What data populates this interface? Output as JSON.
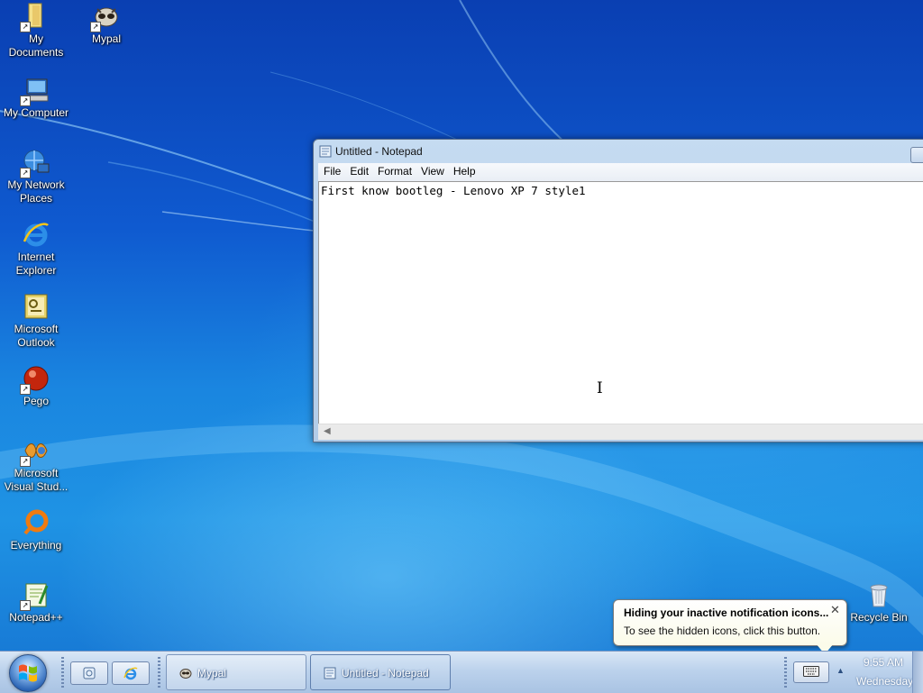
{
  "desktop": {
    "icons": [
      {
        "label": "My Documents",
        "icon": "folder-icon"
      },
      {
        "label": "Mypal",
        "icon": "mypal-icon"
      },
      {
        "label": "My Computer",
        "icon": "computer-icon"
      },
      {
        "label": "My Network Places",
        "icon": "network-icon"
      },
      {
        "label": "Internet Explorer",
        "icon": "ie-icon"
      },
      {
        "label": "Microsoft Outlook",
        "icon": "outlook-icon"
      },
      {
        "label": "Pego",
        "icon": "pego-icon"
      },
      {
        "label": "Microsoft Visual Stud...",
        "icon": "visual-studio-icon"
      },
      {
        "label": "Everything",
        "icon": "everything-icon"
      },
      {
        "label": "Notepad++",
        "icon": "notepadpp-icon"
      },
      {
        "label": "Recycle Bin",
        "icon": "recycle-bin-icon"
      }
    ]
  },
  "notepad": {
    "title": "Untitled - Notepad",
    "menu": [
      "File",
      "Edit",
      "Format",
      "View",
      "Help"
    ],
    "content": "First know bootleg - Lenovo XP 7 style1"
  },
  "balloon": {
    "title": "Hiding your inactive notification icons...",
    "body": "To see the hidden icons, click this button."
  },
  "taskbar": {
    "tasks": [
      {
        "label": "Mypal",
        "active": false
      },
      {
        "label": "Untitled - Notepad",
        "active": true
      }
    ],
    "clock": {
      "time": "9:55 AM",
      "day": "Wednesday"
    }
  },
  "colors": {
    "taskbar": "#bcd2ec",
    "desktop": "#1466c8",
    "balloon": "#fbfbe9"
  }
}
